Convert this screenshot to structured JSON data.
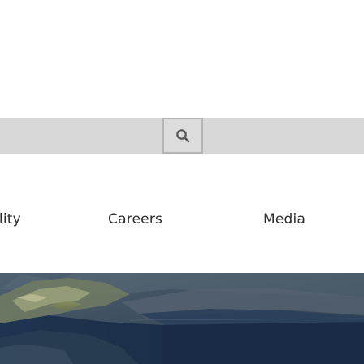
{
  "search": {
    "button_icon": "search-icon"
  },
  "nav": {
    "items": [
      {
        "label": "ility"
      },
      {
        "label": "Careers"
      },
      {
        "label": "Media"
      }
    ]
  },
  "hero": {
    "image": "aerial-landscape-photo"
  },
  "colors": {
    "search_bar": "#d7d7d7",
    "search_button_border": "#b5b5b5",
    "nav_text": "#2d2d2d",
    "hero_base": "#3c5060"
  }
}
